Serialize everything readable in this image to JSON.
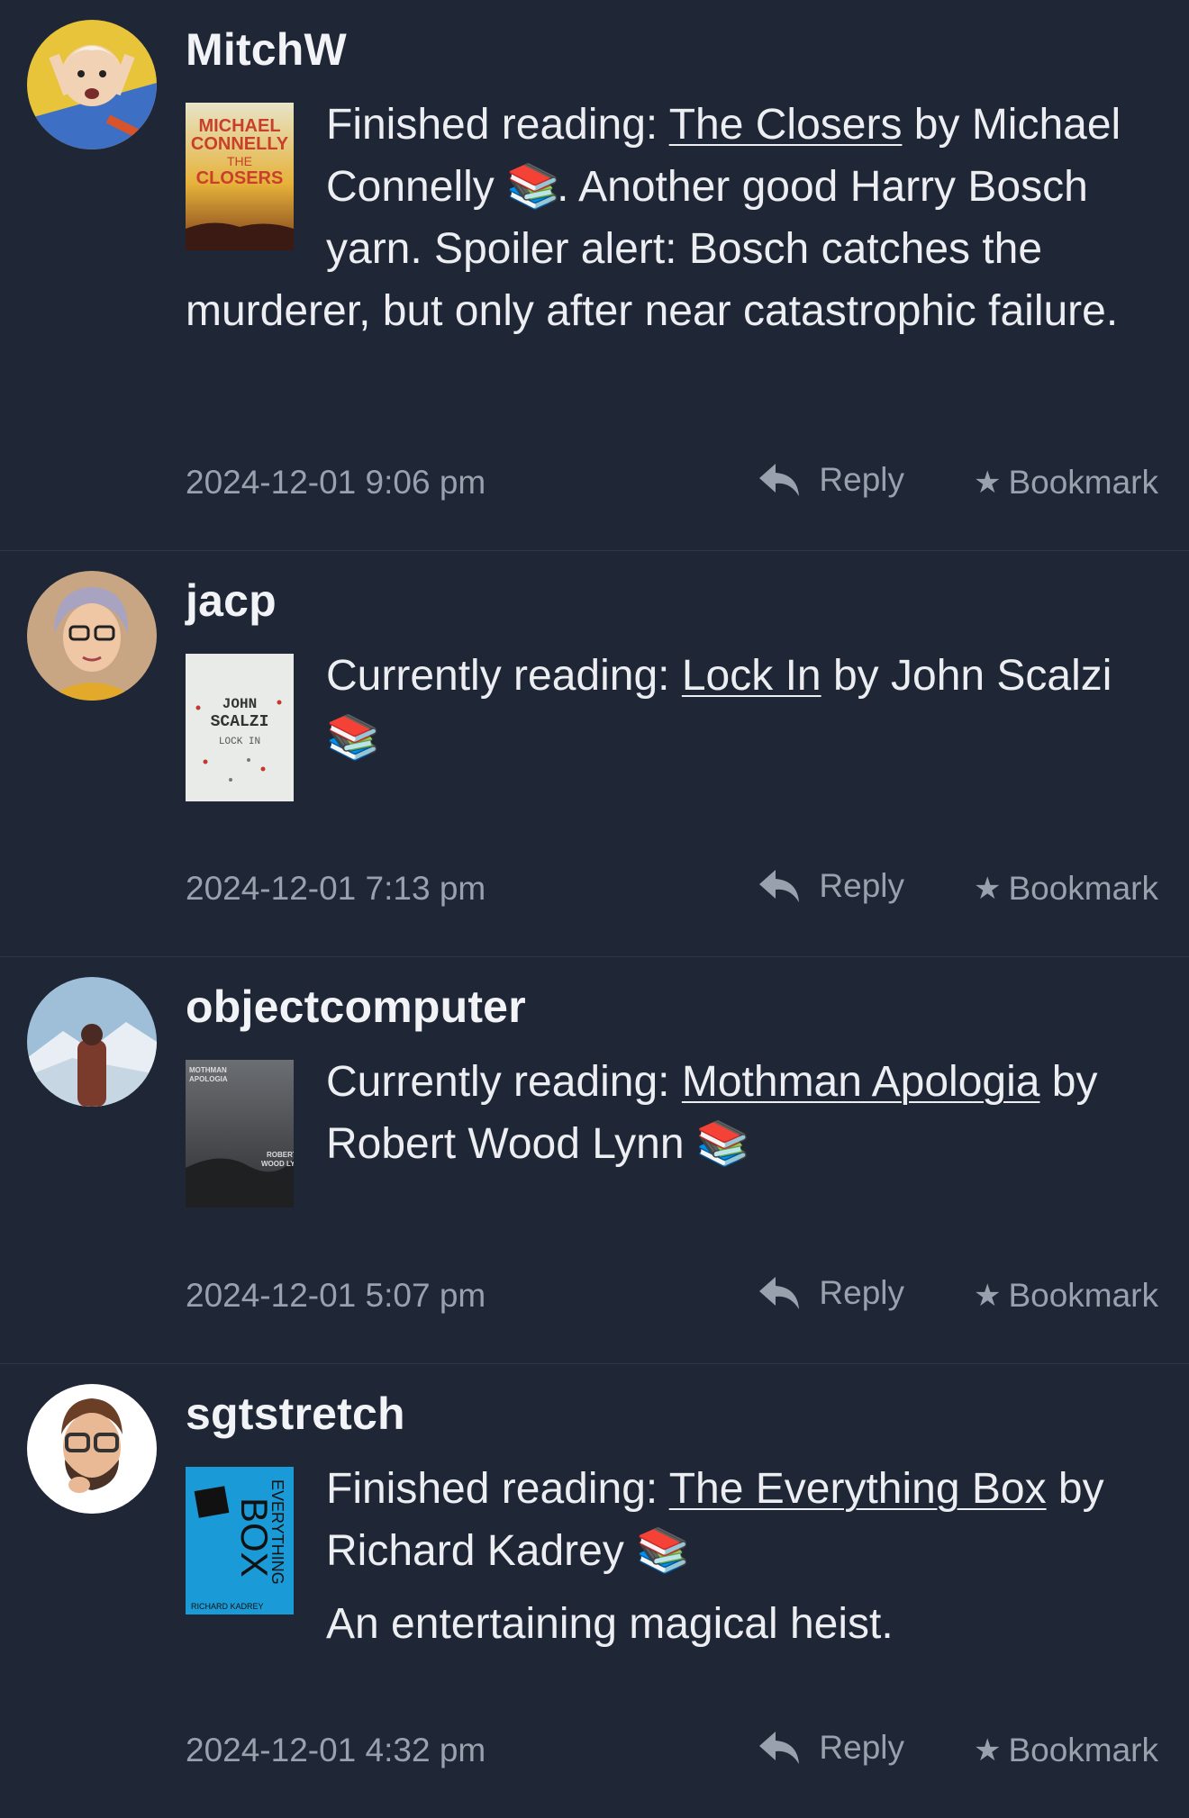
{
  "posts": [
    {
      "username": "MitchW",
      "prefix": "Finished reading: ",
      "book_title": "The Closers",
      "by_author": " by Michael Connelly ",
      "emoji": "📚",
      "after": ". Another good Harry Bosch yarn. Spoiler alert: Bosch catches the murderer, but only after near catastrophic failure.",
      "extra": "",
      "cover": {
        "author_line1": "MICHAEL",
        "author_line2": "CONNELLY",
        "title_line1": "THE",
        "title_line2": "CLOSERS"
      },
      "timestamp": "2024-12-01 9:06 pm",
      "reply_label": "Reply",
      "bookmark_label": "Bookmark"
    },
    {
      "username": "jacp",
      "prefix": "Currently reading: ",
      "book_title": "Lock In",
      "by_author": " by John Scalzi ",
      "emoji": "📚",
      "after": "",
      "extra": "",
      "cover": {
        "author_line1": "JOHN",
        "author_line2": "SCALZI",
        "title_line1": "LOCK IN",
        "title_line2": ""
      },
      "timestamp": "2024-12-01 7:13 pm",
      "reply_label": "Reply",
      "bookmark_label": "Bookmark"
    },
    {
      "username": "objectcomputer",
      "prefix": "Currently reading: ",
      "book_title": "Mothman Apologia",
      "by_author": " by Robert Wood Lynn ",
      "emoji": "📚",
      "after": "",
      "extra": "",
      "cover": {
        "author_line1": "ROBERT",
        "author_line2": "WOOD LYNN",
        "title_line1": "MOTHMAN",
        "title_line2": "APOLOGIA"
      },
      "timestamp": "2024-12-01 5:07 pm",
      "reply_label": "Reply",
      "bookmark_label": "Bookmark"
    },
    {
      "username": "sgtstretch",
      "prefix": "Finished reading: ",
      "book_title": "The Everything Box",
      "by_author": " by Richard Kadrey ",
      "emoji": "📚",
      "after": "",
      "extra": "An entertaining magical heist.",
      "cover": {
        "author_line1": "RICHARD KADREY",
        "author_line2": "",
        "title_line1": "EVERYTHING",
        "title_line2": "BOX"
      },
      "timestamp": "2024-12-01 4:32 pm",
      "reply_label": "Reply",
      "bookmark_label": "Bookmark"
    }
  ],
  "colors": {
    "background": "#1f2636",
    "text": "#eceef2",
    "muted": "#9aa1ae",
    "divider": "#2e3647"
  },
  "icons": {
    "reply": "reply-arrow-icon",
    "bookmark": "star-icon",
    "books": "books-emoji"
  }
}
